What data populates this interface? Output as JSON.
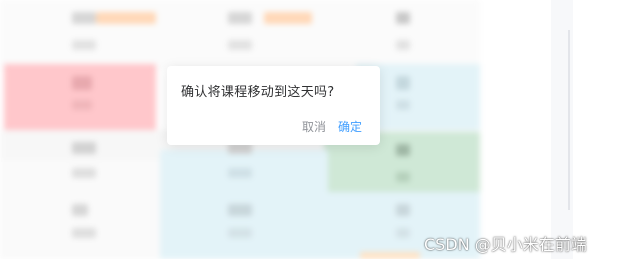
{
  "popconfirm": {
    "message": "确认将课程移动到这天吗?",
    "cancel_label": "取消",
    "confirm_label": "确定"
  },
  "watermark": "CSDN @贝小米在前端",
  "colors": {
    "red_cell": "#ffc7cb",
    "blue_cell": "#e3f3f8",
    "green_cell": "#cfe8d6",
    "orange_tag": "#ffd8b8",
    "primary": "#409eff",
    "muted": "#909399",
    "text": "#303133"
  }
}
